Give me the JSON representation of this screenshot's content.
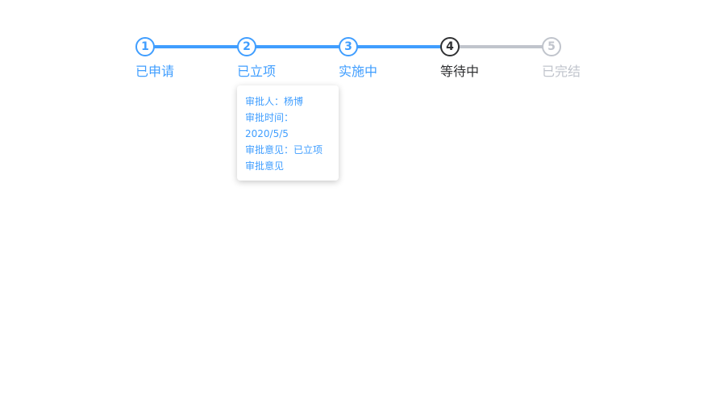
{
  "colors": {
    "active": "#409eff",
    "current": "#303133",
    "pending": "#c0c4cc",
    "line_done": "#409eff",
    "line_pending": "#c0c4cc"
  },
  "steps": [
    {
      "number": "1",
      "label": "已申请",
      "status": "done"
    },
    {
      "number": "2",
      "label": "已立项",
      "status": "done"
    },
    {
      "number": "3",
      "label": "实施中",
      "status": "done"
    },
    {
      "number": "4",
      "label": "等待中",
      "status": "current"
    },
    {
      "number": "5",
      "label": "已完结",
      "status": "pending"
    }
  ],
  "tooltip": {
    "approver": "审批人：杨博",
    "time_label": "审批时间：",
    "time_value": "2020/5/5",
    "opinion_line1": "审批意见：已立项",
    "opinion_line2": "审批意见"
  }
}
